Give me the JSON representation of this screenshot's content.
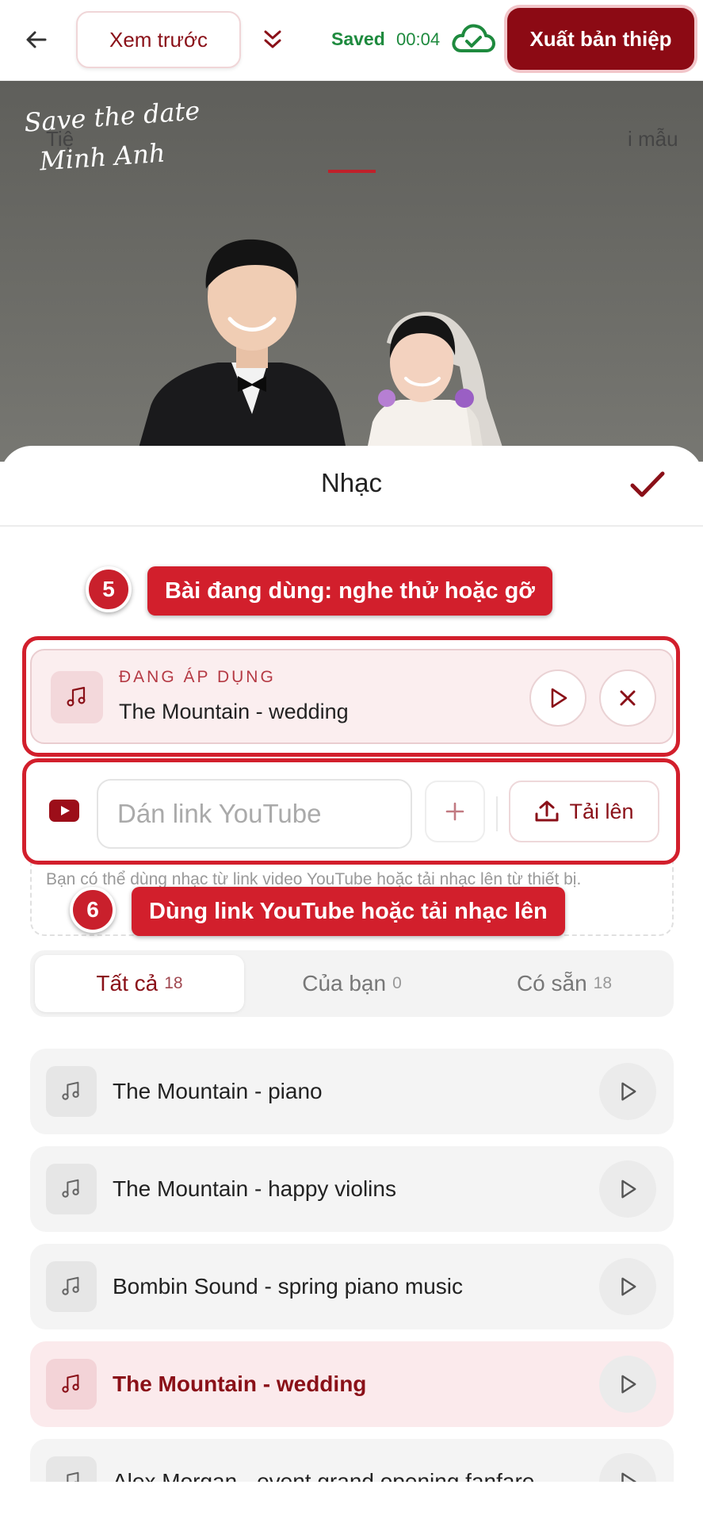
{
  "header": {
    "preview_label": "Xem trước",
    "saved_label": "Saved",
    "saved_time": "00:04",
    "export_label": "Xuất bản thiệp"
  },
  "hero": {
    "script_line1": "Save the date",
    "script_line2": "Minh Anh"
  },
  "sheet": {
    "title": "Nhạc",
    "subtab_left": "Tiệ",
    "subtab_right": "i mẫu"
  },
  "callouts": [
    {
      "number": "5",
      "label": "Bài đang dùng: nghe thử hoặc gỡ"
    },
    {
      "number": "6",
      "label": "Dùng link YouTube hoặc tải nhạc lên"
    }
  ],
  "current": {
    "status": "ĐANG ÁP DỤNG",
    "title": "The Mountain - wedding"
  },
  "youtube": {
    "placeholder": "Dán link YouTube",
    "upload_label": "Tải lên",
    "hint": "Bạn có thể dùng nhạc từ link video YouTube hoặc tải nhạc lên từ thiết bị."
  },
  "filters": [
    {
      "label": "Tất cả",
      "count": "18"
    },
    {
      "label": "Của bạn",
      "count": "0"
    },
    {
      "label": "Có sẵn",
      "count": "18"
    }
  ],
  "tracks": [
    {
      "title": "The Mountain - piano",
      "active": false
    },
    {
      "title": "The Mountain - happy violins",
      "active": false
    },
    {
      "title": "Bombin Sound - spring piano music",
      "active": false
    },
    {
      "title": "The Mountain - wedding",
      "active": true
    },
    {
      "title": "Alex Morgan - event grand opening fanfare",
      "active": false
    }
  ],
  "colors": {
    "accent": "#8c0a14",
    "callout": "#d21f2c",
    "saved": "#1e8a3e"
  }
}
